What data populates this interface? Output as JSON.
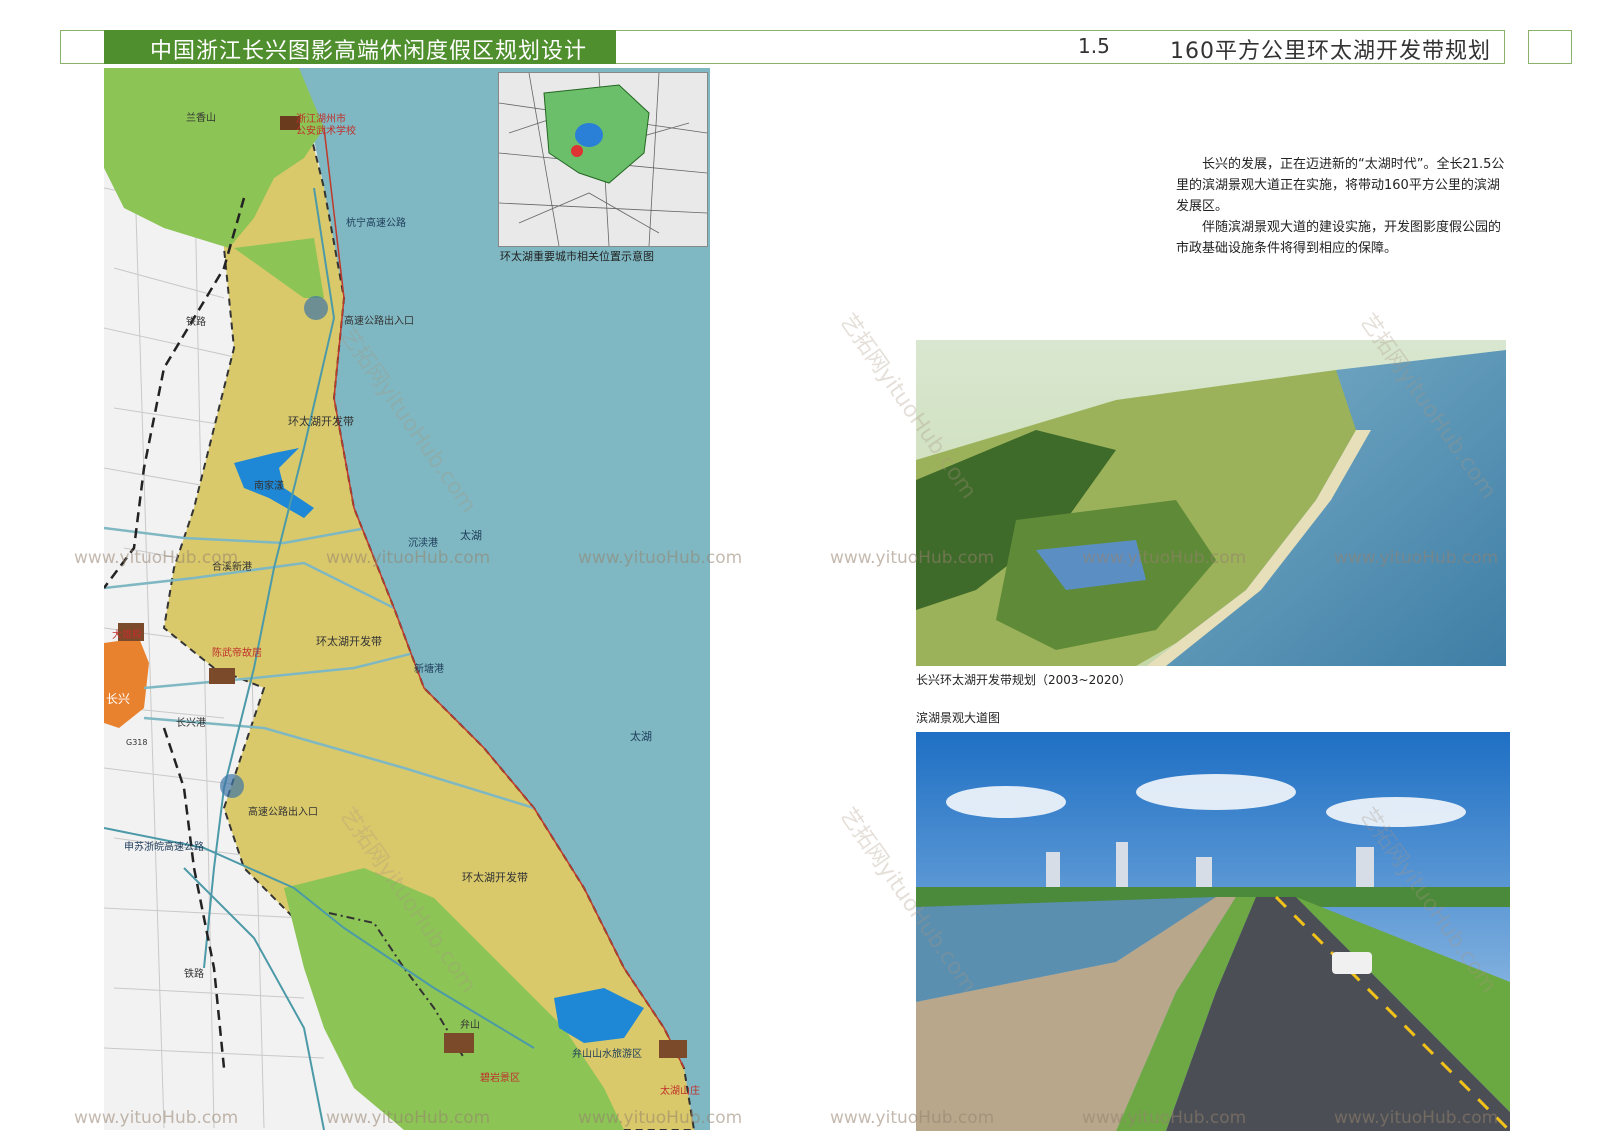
{
  "header": {
    "title": "中国浙江长兴图影高端休闲度假区规划设计",
    "section_number": "1.5",
    "section_title": "160平方公里环太湖开发带规划"
  },
  "map": {
    "labels": {
      "lanxiang": "兰香山",
      "school": "浙江湖州市\n公安武术学校",
      "expressway": "杭宁高速公路",
      "railway_top": "铁路",
      "exit1": "高速公路出入口",
      "zone1": "环太湖开发带",
      "lake_small": "南家漾",
      "port1": "沉渎港",
      "taihu1": "太湖",
      "port2": "合溪新港",
      "dagong": "大雄殿",
      "zone2": "环太湖开发带",
      "chenwu": "陈武帝故居",
      "changxing": "长兴",
      "port3": "新塘港",
      "port4": "长兴港",
      "taihu2": "太湖",
      "exit2": "高速公路出入口",
      "shenshan": "申苏浙皖高速公路",
      "zone3": "环太湖开发带",
      "railway_bottom": "铁路",
      "bianshan": "弁山",
      "water_park": "弁山山水旅游区",
      "biyan": "碧岩景区",
      "taihu_mtn": "太湖山庄",
      "g318": "G318"
    },
    "inset_caption": "环太湖重要城市相关位置示意图"
  },
  "description": [
    "长兴的发展，正在迈进新的“太湖时代”。全长21.5公里的滨湖景观大道正在实施，将带动160平方公里的滨湖发展区。",
    "伴随滨湖景观大道的建设实施，开发图影度假公园的市政基础设施条件将得到相应的保障。"
  ],
  "photos": {
    "aerial_caption": "长兴环太湖开发带规划（2003~2020）",
    "road_caption": "滨湖景观大道图"
  },
  "watermark": "www.yituoHub.com",
  "watermark_diag": "艺拓网yituoHub.com",
  "colors": {
    "header_green": "#4f8f2e",
    "lake_blue": "#7fb8c2",
    "zone_yellow": "#d9c96a",
    "green_area": "#8cc456",
    "town_orange": "#e8822f"
  }
}
